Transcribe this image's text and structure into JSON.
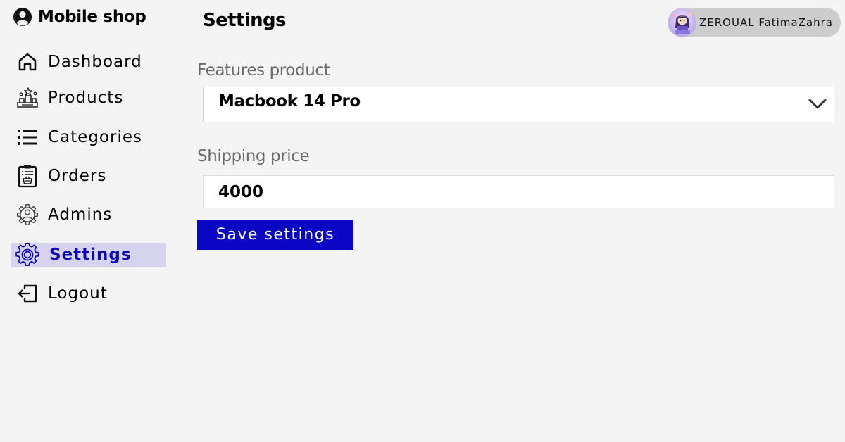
{
  "brand": {
    "name": "Mobile shop",
    "icon": "account-circle-icon"
  },
  "sidebar": {
    "items": [
      {
        "label": "Dashboard",
        "icon": "home-icon",
        "active": false
      },
      {
        "label": "Products",
        "icon": "products-icon",
        "active": false
      },
      {
        "label": "Categories",
        "icon": "list-icon",
        "active": false
      },
      {
        "label": "Orders",
        "icon": "clipboard-basket-icon",
        "active": false
      },
      {
        "label": "Admins",
        "icon": "admin-gear-icon",
        "active": false
      },
      {
        "label": "Settings",
        "icon": "gear-icon",
        "active": true
      },
      {
        "label": "Logout",
        "icon": "logout-icon",
        "active": false
      }
    ]
  },
  "header": {
    "title": "Settings",
    "user_name": "ZEROUAL FatimaZahra",
    "avatar_icon": "avatar"
  },
  "form": {
    "featured_label": "Features product",
    "featured_value": "Macbook 14 Pro",
    "featured_icon": "chevron-down-icon",
    "shipping_label": "Shipping price",
    "shipping_value": "4000",
    "save_label": "Save settings"
  },
  "colors": {
    "accent": "#0b06c4",
    "active_bg": "#d6d3ef",
    "background": "#f4f4f4",
    "label_gray": "#6b6b6b",
    "user_chip": "#cdcdcd"
  }
}
